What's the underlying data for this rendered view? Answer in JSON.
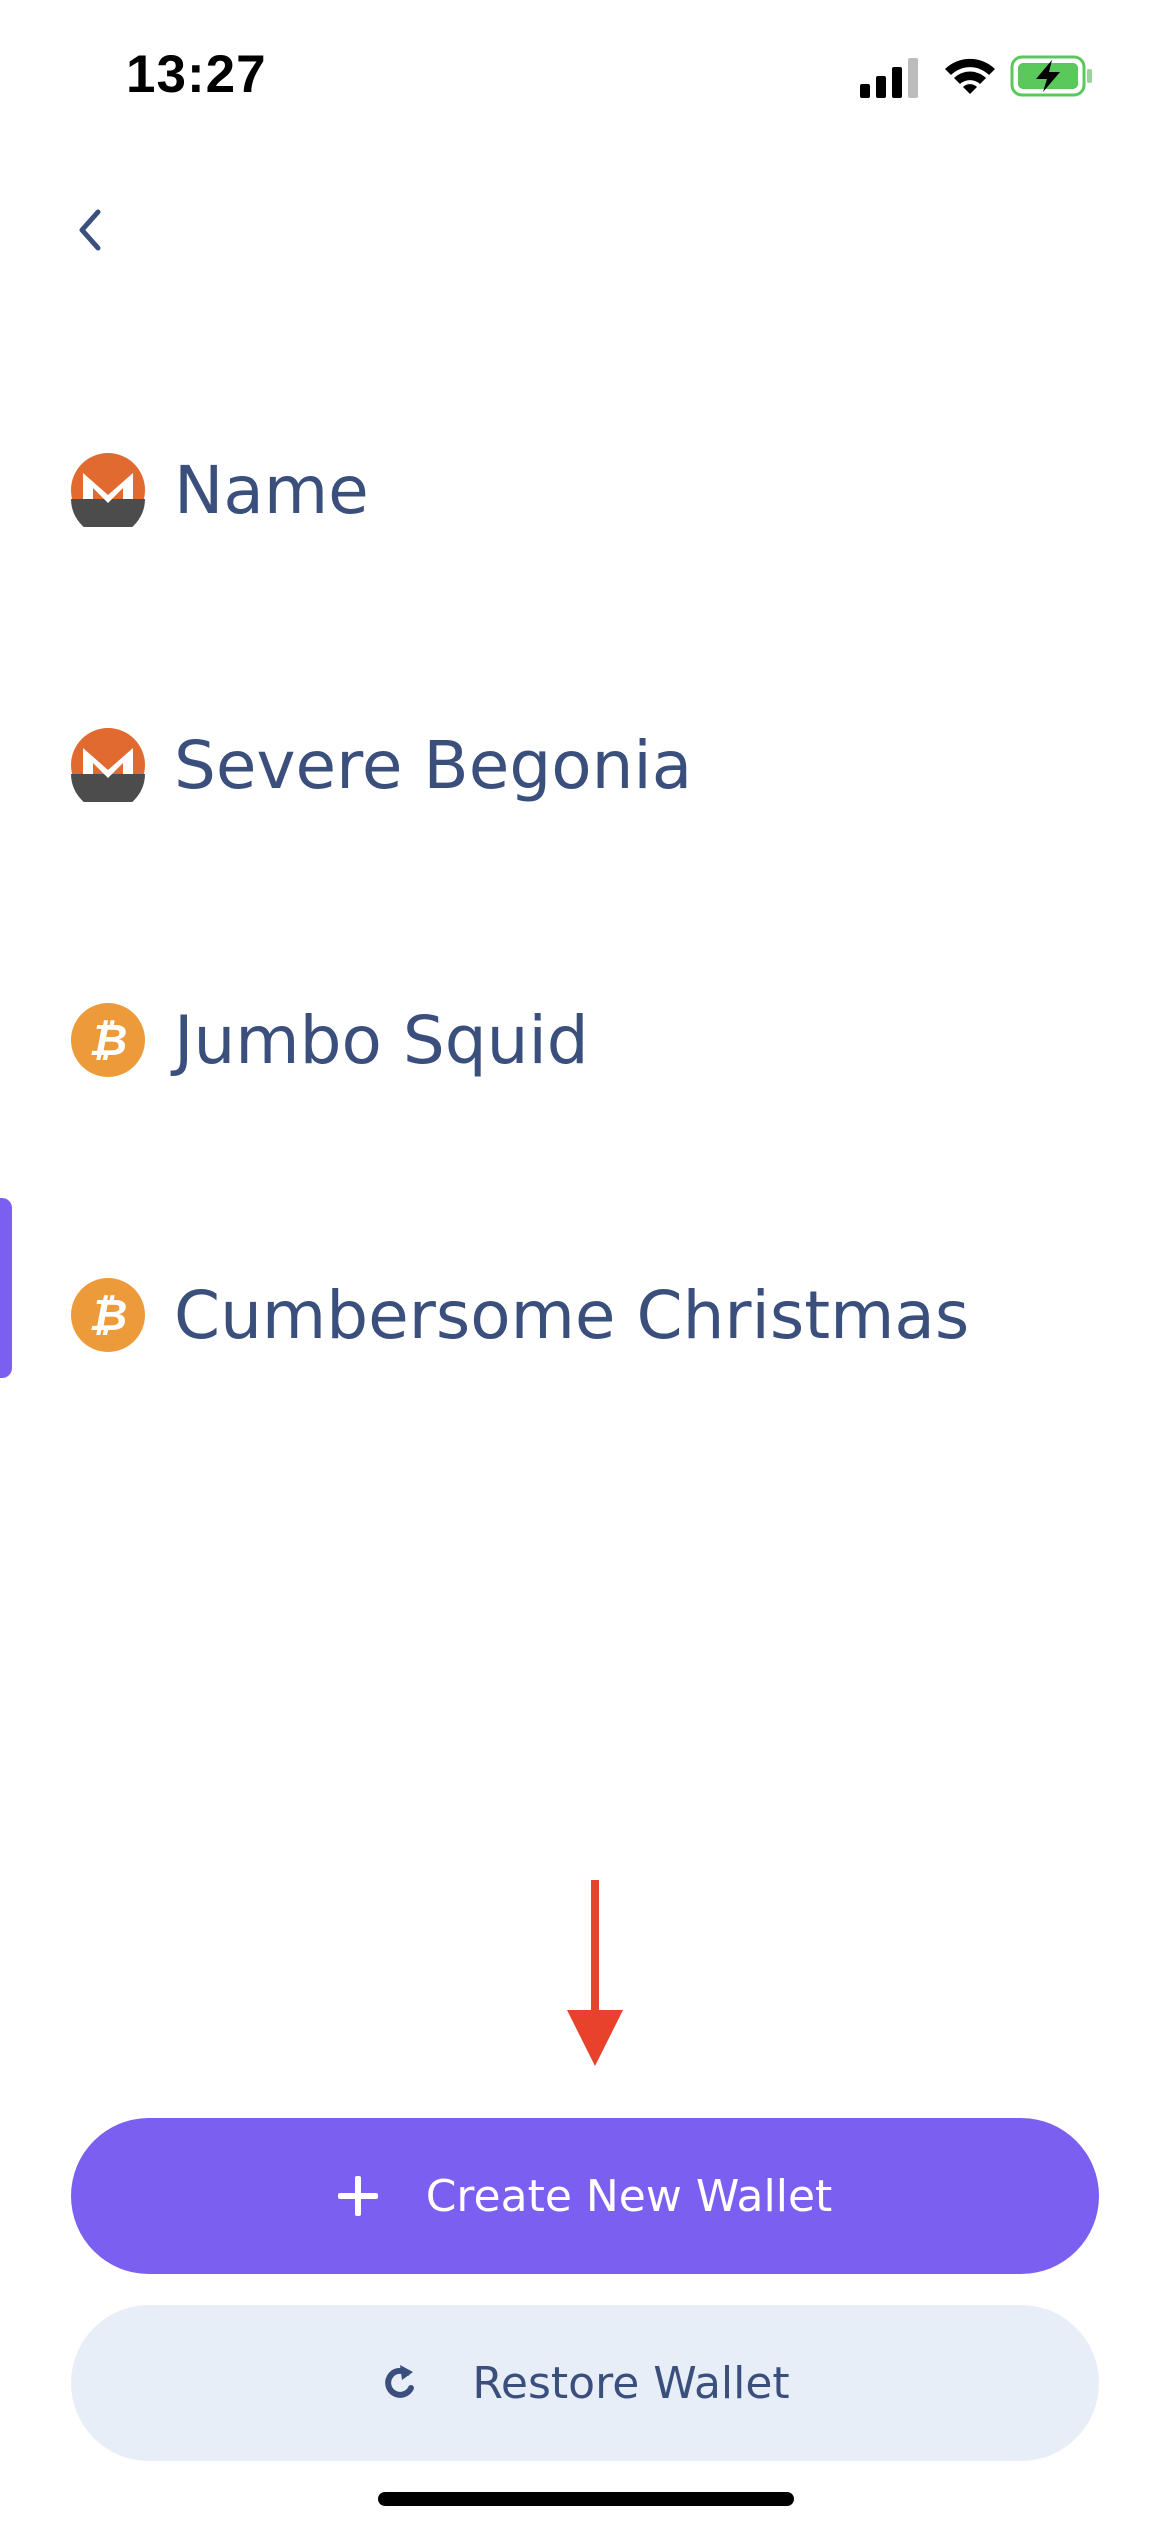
{
  "status_bar": {
    "time": "13:27",
    "icons": [
      "signal-icon",
      "wifi-icon",
      "battery-charging-icon"
    ]
  },
  "nav": {
    "back_icon": "chevron-left-icon"
  },
  "wallets": [
    {
      "name": "Name",
      "coin_icon": "monero-icon"
    },
    {
      "name": "Severe Begonia",
      "coin_icon": "monero-icon"
    },
    {
      "name": "Jumbo Squid",
      "coin_icon": "bitcoin-icon"
    },
    {
      "name": "Cumbersome Christmas",
      "coin_icon": "bitcoin-icon",
      "selected": true
    }
  ],
  "actions": {
    "create_label": "Create New Wallet",
    "create_icon": "plus-icon",
    "restore_label": "Restore Wallet",
    "restore_icon": "refresh-icon"
  },
  "colors": {
    "accent": "#7b5ff0",
    "text": "#3b4f7d",
    "secondary_button_bg": "#e8eef8",
    "monero_orange": "#e06a2f",
    "bitcoin_orange": "#ec9a3a",
    "annotation_arrow": "#e8412c",
    "battery_green": "#5ac85a"
  }
}
